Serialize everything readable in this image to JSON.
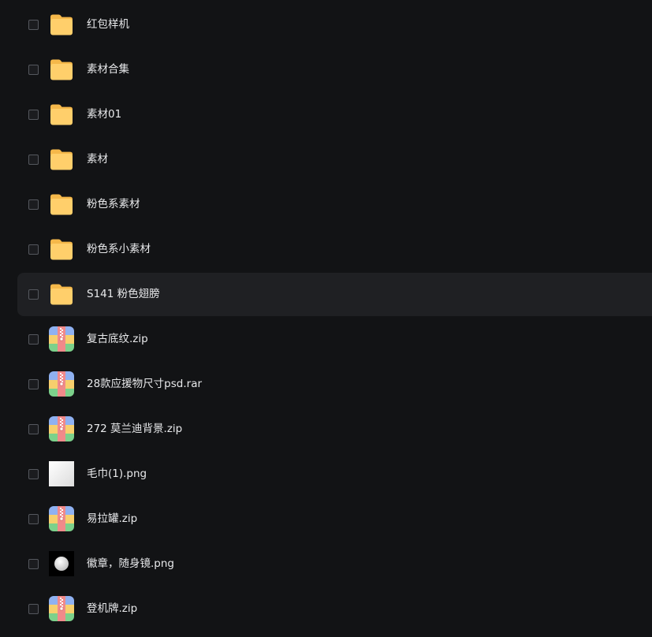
{
  "files": [
    {
      "name": "红包样机",
      "icon": "folder-icon",
      "hover": false
    },
    {
      "name": "素材合集",
      "icon": "folder-icon",
      "hover": false
    },
    {
      "name": "素材01",
      "icon": "folder-icon",
      "hover": false
    },
    {
      "name": "素材",
      "icon": "folder-icon",
      "hover": false
    },
    {
      "name": "粉色系素材",
      "icon": "folder-icon",
      "hover": false
    },
    {
      "name": "粉色系小素材",
      "icon": "folder-icon",
      "hover": false
    },
    {
      "name": "S141 粉色翅膀",
      "icon": "folder-icon",
      "hover": true
    },
    {
      "name": "复古底纹.zip",
      "icon": "archive-icon",
      "hover": false
    },
    {
      "name": "28款应援物尺寸psd.rar",
      "icon": "archive-icon",
      "hover": false
    },
    {
      "name": "272 莫兰迪背景.zip",
      "icon": "archive-icon",
      "hover": false
    },
    {
      "name": "毛巾(1).png",
      "icon": "image-thumbnail-icon",
      "hover": false
    },
    {
      "name": "易拉罐.zip",
      "icon": "archive-icon",
      "hover": false
    },
    {
      "name": "徽章，随身镜.png",
      "icon": "badge-thumbnail-icon",
      "hover": false
    },
    {
      "name": "登机牌.zip",
      "icon": "archive-icon",
      "hover": false
    }
  ],
  "colors": {
    "background": "#121315",
    "row_hover": "#1f2023",
    "text": "#e8e9eb",
    "folder_front": "#ffcf6b",
    "folder_back": "#f5b84a"
  }
}
